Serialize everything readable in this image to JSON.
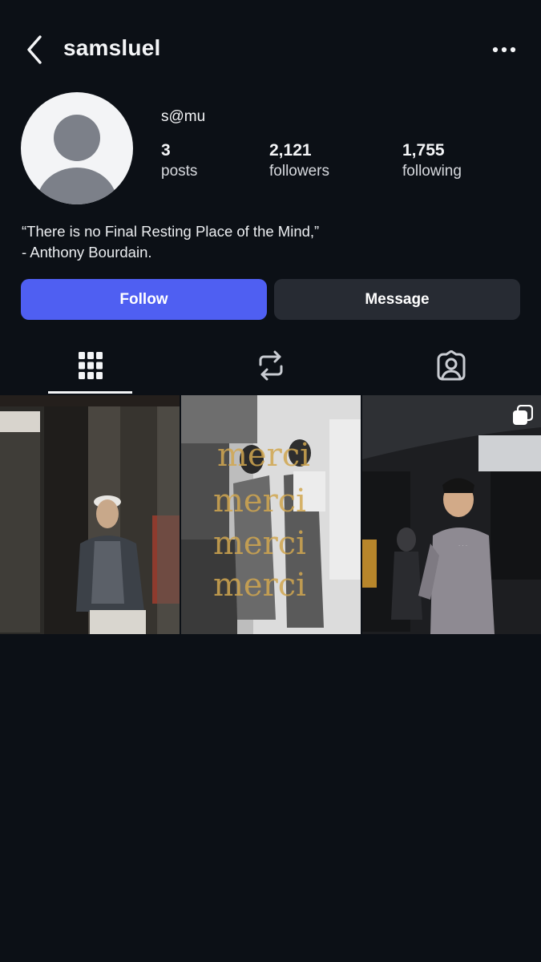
{
  "header": {
    "username": "samsluel",
    "back_icon": "chevron-left-icon",
    "more_icon": "more-horizontal-icon"
  },
  "profile": {
    "display_name": "s@mu",
    "avatar": "default-avatar",
    "stats": {
      "posts": {
        "value": "3",
        "label": "posts"
      },
      "followers": {
        "value": "2,121",
        "label": "followers"
      },
      "following": {
        "value": "1,755",
        "label": "following"
      }
    },
    "bio_lines": [
      "“There is no Final Resting Place of the Mind,”",
      "- Anthony Bourdain."
    ]
  },
  "actions": {
    "follow_label": "Follow",
    "message_label": "Message"
  },
  "tabs": [
    {
      "icon": "grid-icon",
      "active": true
    },
    {
      "icon": "repost-icon",
      "active": false
    },
    {
      "icon": "tagged-icon",
      "active": false
    }
  ],
  "posts": [
    {
      "id": "post-1",
      "multi": false
    },
    {
      "id": "post-2",
      "multi": false,
      "overlay_text": [
        "merci",
        "merci",
        "merci",
        "merci"
      ]
    },
    {
      "id": "post-3",
      "multi": true
    }
  ],
  "colors": {
    "background": "#0c1016",
    "primary_button": "#4f5ff2",
    "secondary_button": "#272b33",
    "text": "#f4f5f7"
  }
}
